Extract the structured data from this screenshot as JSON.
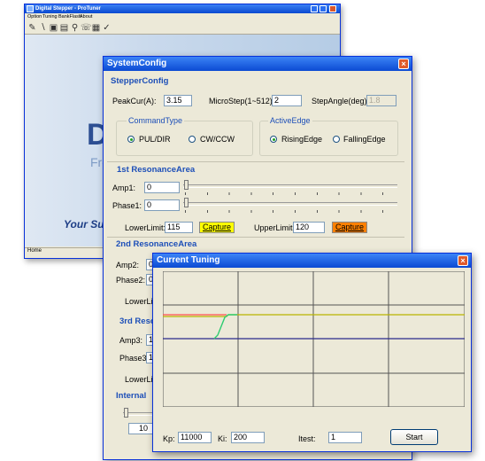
{
  "back_window": {
    "title": "Digital Stepper - ProTuner",
    "menu": [
      "Option",
      "Tuning",
      "BankFlash",
      "About"
    ],
    "toolbar_icons": [
      "open-icon",
      "tune-icon",
      "save-icon",
      "download-icon",
      "settings-icon",
      "scope-icon",
      "check-icon"
    ],
    "splash_title": "Dig",
    "splash_sub": "From a",
    "splash_slogan": "Your Su",
    "status": "Home"
  },
  "system_config": {
    "title": "SystemConfig",
    "close_glyph": "×",
    "stepper": {
      "heading": "StepperConfig",
      "peak_label": "PeakCur(A):",
      "peak_value": "3.15",
      "micro_label": "MicroStep(1~512):",
      "micro_value": "2",
      "angle_label": "StepAngle(deg):",
      "angle_value": "1.8",
      "command_type": {
        "label": "CommandType",
        "opt1": "PUL/DIR",
        "opt2": "CW/CCW",
        "selected": "PUL/DIR"
      },
      "active_edge": {
        "label": "ActiveEdge",
        "opt1": "RisingEdge",
        "opt2": "FallingEdge",
        "selected": "RisingEdge"
      }
    },
    "res1": {
      "heading": "1st ResonanceArea",
      "amp_label": "Amp1:",
      "amp_value": "0",
      "phase_label": "Phase1:",
      "phase_value": "0",
      "lower_label": "LowerLimit:",
      "lower_value": "115",
      "upper_label": "UpperLimit:",
      "upper_value": "120",
      "capture": "Capture"
    },
    "res2": {
      "heading": "2nd ResonanceArea",
      "amp_label": "Amp2:",
      "amp_value": "0",
      "phase_label": "Phase2:",
      "phase_value": "0",
      "lower_label": "LowerLim"
    },
    "res3": {
      "heading": "3rd Reso",
      "amp_label": "Amp3:",
      "amp_value": "1",
      "phase_label": "Phase3:",
      "phase_value": "1",
      "lower_label": "LowerLim"
    },
    "internal": {
      "heading": "Internal",
      "value": "10"
    },
    "colors": {
      "capture_yellow": "#ffff00",
      "capture_orange": "#ff8000",
      "heading": "#1d4fb8"
    }
  },
  "current_tuning": {
    "title": "Current Tuning",
    "close_glyph": "×",
    "kp_label": "Kp:",
    "kp_value": "11000",
    "ki_label": "Ki:",
    "ki_value": "200",
    "itest_label": "Itest:",
    "itest_value": "1",
    "start": "Start",
    "colors": {
      "background": "#ece9d8",
      "command": "#ff5050",
      "response": "#2ecc71",
      "reference": "#b8b400",
      "zero": "#2a2a8a"
    }
  }
}
